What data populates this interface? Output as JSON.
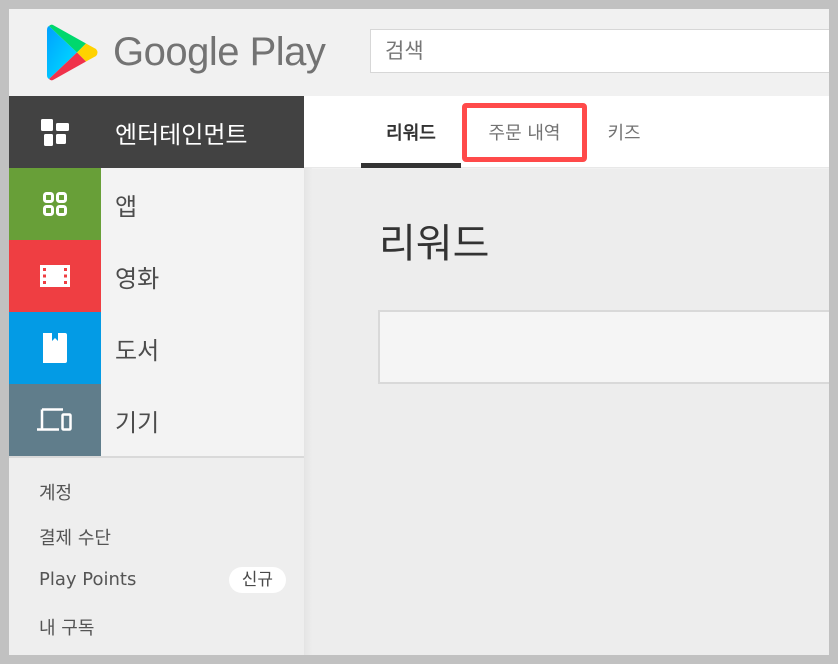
{
  "header": {
    "brand": "Google Play",
    "search_placeholder": "검색"
  },
  "sidebar": {
    "category_header": {
      "label": "엔터테인먼트",
      "icon": "entertainment-icon",
      "color": "#424242"
    },
    "categories": [
      {
        "label": "앱",
        "icon": "apps-grid-icon",
        "color": "#689f38"
      },
      {
        "label": "영화",
        "icon": "film-icon",
        "color": "#ef3e42"
      },
      {
        "label": "도서",
        "icon": "book-icon",
        "color": "#039be5"
      },
      {
        "label": "기기",
        "icon": "devices-icon",
        "color": "#607d8b"
      }
    ],
    "account_links": [
      {
        "label": "계정"
      },
      {
        "label": "결제 수단"
      },
      {
        "label": "Play Points",
        "badge": "신규"
      },
      {
        "label": "내 구독"
      }
    ]
  },
  "tabs": {
    "items": [
      {
        "label": "리워드",
        "active": true
      },
      {
        "label": "주문 내역",
        "active": false,
        "highlighted": true
      },
      {
        "label": "키즈",
        "active": false
      }
    ],
    "highlight_color": "#ff4a4a"
  },
  "main": {
    "title": "리워드"
  }
}
